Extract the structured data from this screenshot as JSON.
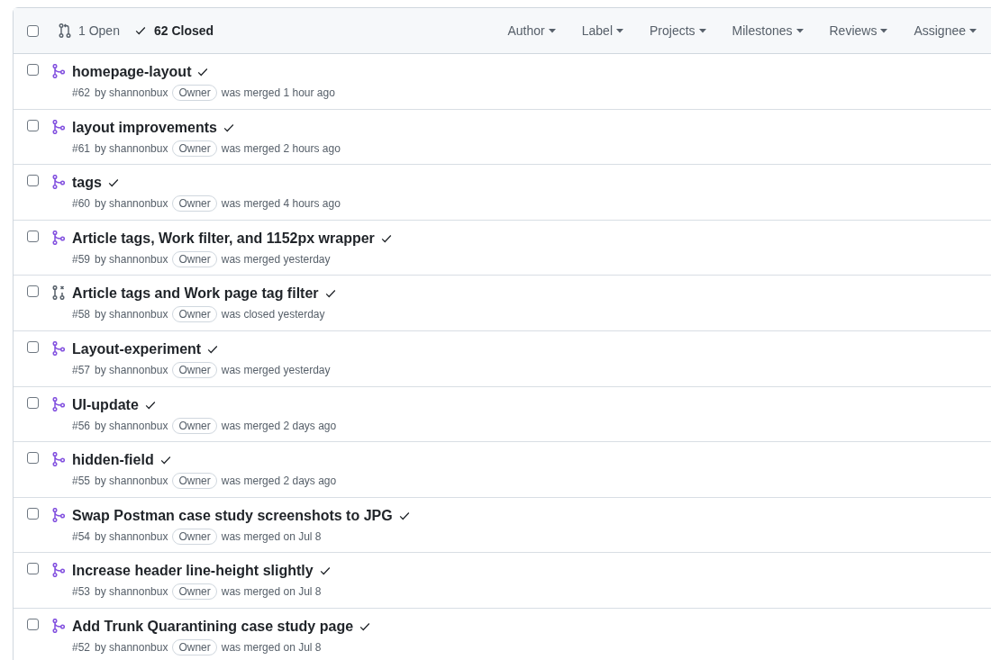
{
  "header": {
    "select_all_checked": false,
    "states": [
      {
        "label": "1 Open",
        "selected": false
      },
      {
        "label": "62 Closed",
        "selected": true
      }
    ],
    "filters": [
      "Author",
      "Label",
      "Projects",
      "Milestones",
      "Reviews",
      "Assignee"
    ]
  },
  "pull_requests": [
    {
      "title": "homepage-layout",
      "checked": false,
      "kind": "merged",
      "number": "#62",
      "author": "by shannonbux",
      "badge": "Owner",
      "status": "was merged 1 hour ago"
    },
    {
      "title": "layout improvements",
      "checked": false,
      "kind": "merged",
      "number": "#61",
      "author": "by shannonbux",
      "badge": "Owner",
      "status": "was merged 2 hours ago"
    },
    {
      "title": "tags",
      "checked": false,
      "kind": "merged",
      "number": "#60",
      "author": "by shannonbux",
      "badge": "Owner",
      "status": "was merged 4 hours ago"
    },
    {
      "title": "Article tags, Work filter, and 1152px wrapper",
      "checked": false,
      "kind": "merged",
      "number": "#59",
      "author": "by shannonbux",
      "badge": "Owner",
      "status": "was merged yesterday"
    },
    {
      "title": "Article tags and Work page tag filter",
      "checked": false,
      "kind": "closed",
      "number": "#58",
      "author": "by shannonbux",
      "badge": "Owner",
      "status": "was closed yesterday"
    },
    {
      "title": "Layout-experiment",
      "checked": false,
      "kind": "merged",
      "number": "#57",
      "author": "by shannonbux",
      "badge": "Owner",
      "status": "was merged yesterday"
    },
    {
      "title": "UI-update",
      "checked": false,
      "kind": "merged",
      "number": "#56",
      "author": "by shannonbux",
      "badge": "Owner",
      "status": "was merged 2 days ago"
    },
    {
      "title": "hidden-field",
      "checked": false,
      "kind": "merged",
      "number": "#55",
      "author": "by shannonbux",
      "badge": "Owner",
      "status": "was merged 2 days ago"
    },
    {
      "title": "Swap Postman case study screenshots to JPG",
      "checked": false,
      "kind": "merged",
      "number": "#54",
      "author": "by shannonbux",
      "badge": "Owner",
      "status": "was merged on Jul 8"
    },
    {
      "title": "Increase header line-height slightly",
      "checked": false,
      "kind": "merged",
      "number": "#53",
      "author": "by shannonbux",
      "badge": "Owner",
      "status": "was merged on Jul 8"
    },
    {
      "title": "Add Trunk Quarantining case study page",
      "checked": false,
      "kind": "merged",
      "number": "#52",
      "author": "by shannonbux",
      "badge": "Owner",
      "status": "was merged on Jul 8"
    }
  ]
}
